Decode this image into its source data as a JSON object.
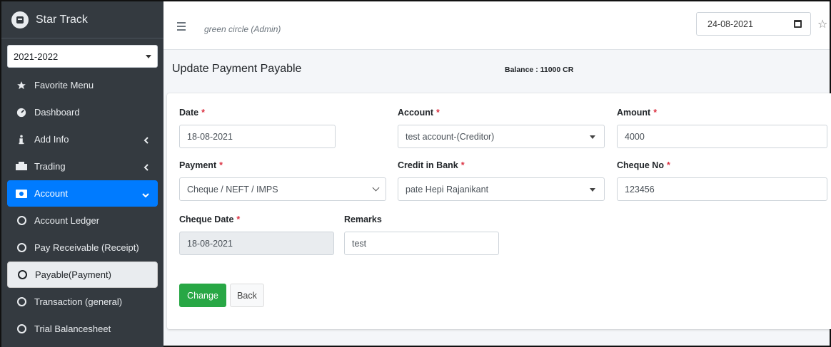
{
  "brand": {
    "name": "Star Track"
  },
  "sidebar": {
    "year": "2021-2022",
    "items": [
      {
        "label": "Favorite Menu",
        "icon": "star-icon"
      },
      {
        "label": "Dashboard",
        "icon": "dashboard-icon"
      },
      {
        "label": "Add Info",
        "icon": "info-icon"
      },
      {
        "label": "Trading",
        "icon": "truck-icon"
      },
      {
        "label": "Account",
        "icon": "money-icon"
      },
      {
        "label": "Account Ledger",
        "icon": "circle-icon"
      },
      {
        "label": "Pay Receivable (Receipt)",
        "icon": "circle-icon"
      },
      {
        "label": "Payable(Payment)",
        "icon": "circle-icon"
      },
      {
        "label": "Transaction (general)",
        "icon": "circle-icon"
      },
      {
        "label": "Trial Balancesheet",
        "icon": "circle-icon"
      }
    ]
  },
  "header": {
    "user": "green circle (Admin)",
    "date": "24-08-2021"
  },
  "page": {
    "title": "Update Payment Payable",
    "balance": "Balance : 11000 CR"
  },
  "form": {
    "required_mark": "*",
    "date": {
      "label": "Date",
      "value": "18-08-2021"
    },
    "account": {
      "label": "Account",
      "value": "test account-(Creditor)"
    },
    "amount": {
      "label": "Amount",
      "value": "4000"
    },
    "payment": {
      "label": "Payment",
      "value": "Cheque / NEFT / IMPS"
    },
    "credit_bank": {
      "label": "Credit in Bank",
      "value": "pate Hepi Rajanikant"
    },
    "cheque_no": {
      "label": "Cheque No",
      "value": "123456"
    },
    "cheque_date": {
      "label": "Cheque Date",
      "value": "18-08-2021"
    },
    "remarks": {
      "label": "Remarks",
      "value": "test"
    },
    "change_label": "Change",
    "back_label": "Back"
  },
  "colors": {
    "sidebar_bg": "#343a40",
    "active": "#007bff",
    "success": "#28a745",
    "required": "#dc3545"
  }
}
